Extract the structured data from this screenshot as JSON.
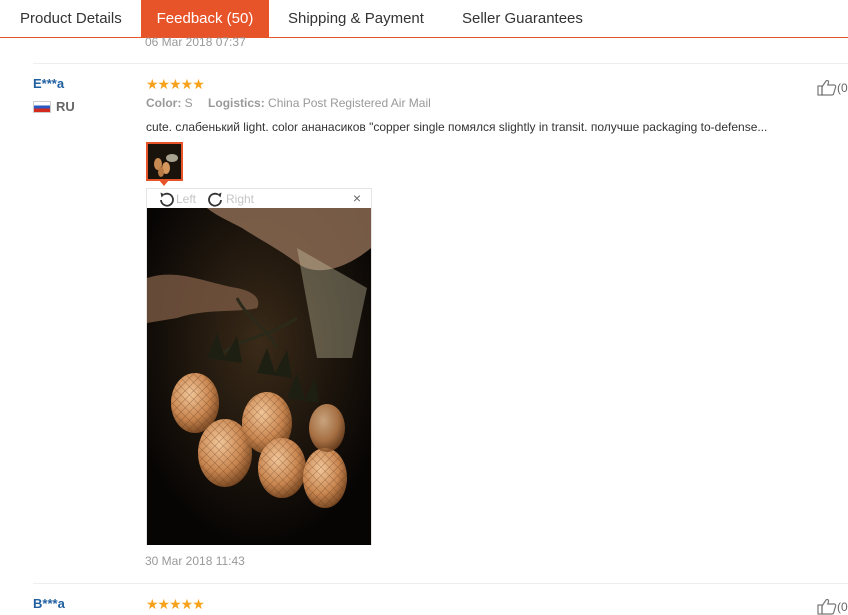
{
  "tabs": [
    {
      "label": "Product Details"
    },
    {
      "label": "Feedback (50)"
    },
    {
      "label": "Shipping & Payment"
    },
    {
      "label": "Seller Guarantees"
    }
  ],
  "previous_review": {
    "date": "06 Mar 2018 07:37"
  },
  "review": {
    "user": "E***a",
    "country": "RU",
    "stars": "★★★★★",
    "color_label": "Color:",
    "color_value": "S",
    "logistics_label": "Logistics:",
    "logistics_value": "China Post Registered Air Mail",
    "text": "cute. слабенький light. color ананасиков \"copper single помялся slightly in transit. получше packaging to-defense...",
    "date": "30 Mar 2018 11:43",
    "like_count": "(0",
    "rating": 5
  },
  "viewer": {
    "rotate_left": "Left",
    "rotate_right": "Right",
    "close": "×"
  },
  "next_review": {
    "user": "B***a",
    "stars": "★★★★★",
    "like_count": "(0"
  },
  "colors": {
    "accent": "#e8542a",
    "user_link": "#1f5fa0",
    "star": "#f7a21a"
  }
}
